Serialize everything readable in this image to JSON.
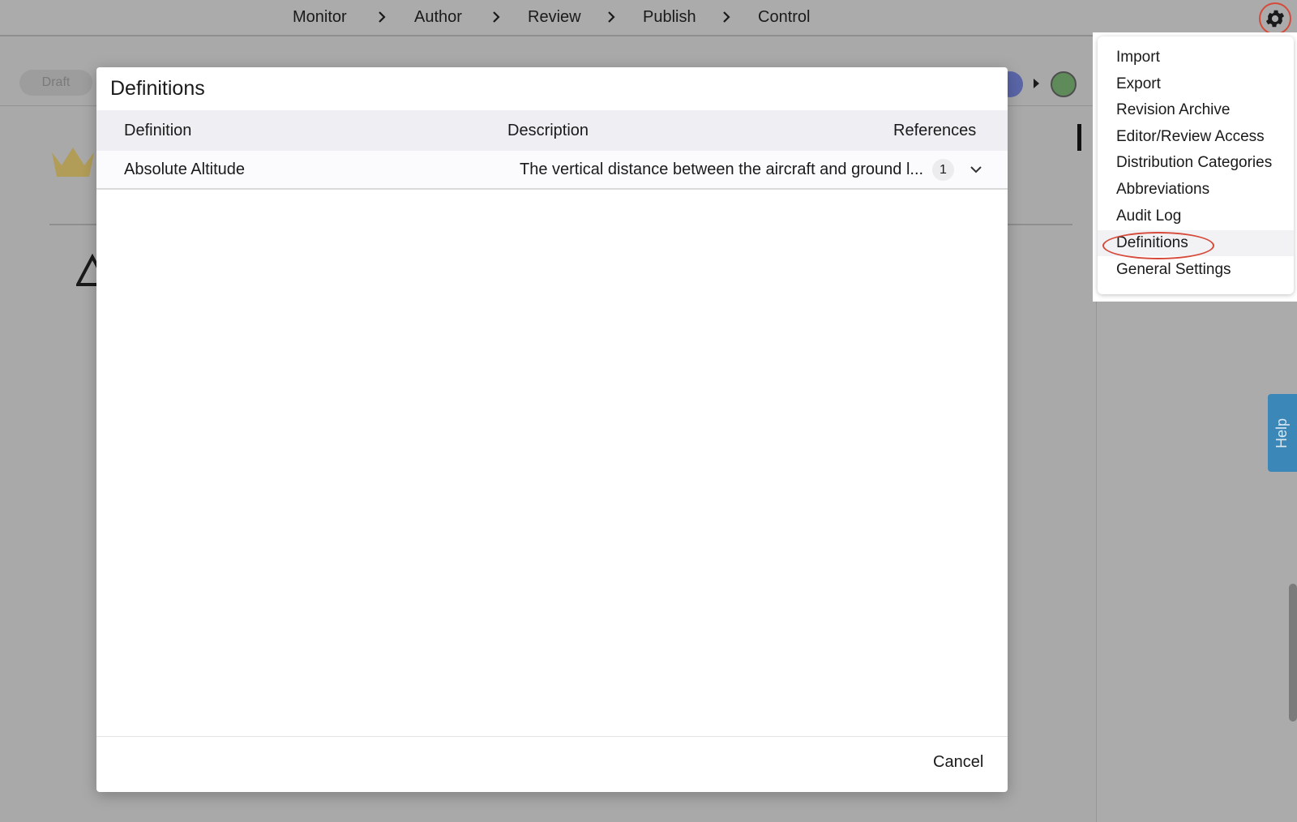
{
  "nav": {
    "steps": [
      "Monitor",
      "Author",
      "Review",
      "Publish",
      "Control"
    ]
  },
  "background": {
    "status_badge": "Draft"
  },
  "modal": {
    "title": "Definitions",
    "columns": [
      "Definition",
      "Description",
      "References"
    ],
    "rows": [
      {
        "definition": "Absolute Altitude",
        "description": "The vertical distance between the aircraft and ground l...",
        "references": "1"
      }
    ],
    "cancel_label": "Cancel"
  },
  "settings_menu": {
    "items": [
      "Import",
      "Export",
      "Revision Archive",
      "Editor/Review Access",
      "Distribution Categories",
      "Abbreviations",
      "Audit Log",
      "Definitions",
      "General Settings"
    ],
    "selected": "Definitions"
  },
  "help_tab": {
    "label": "Help"
  },
  "icons": {
    "settings": "gear-icon",
    "nav_separator": "chevron-right-icon",
    "row_expand": "chevron-down-icon",
    "logo": "crown-icon",
    "warning": "triangle-icon"
  },
  "colors": {
    "highlight": "#d64a3a",
    "help_tab": "#3b87b7",
    "stage_blue": "#5a66a8",
    "stage_green": "#5f8a5a",
    "crown": "#c9a534"
  }
}
